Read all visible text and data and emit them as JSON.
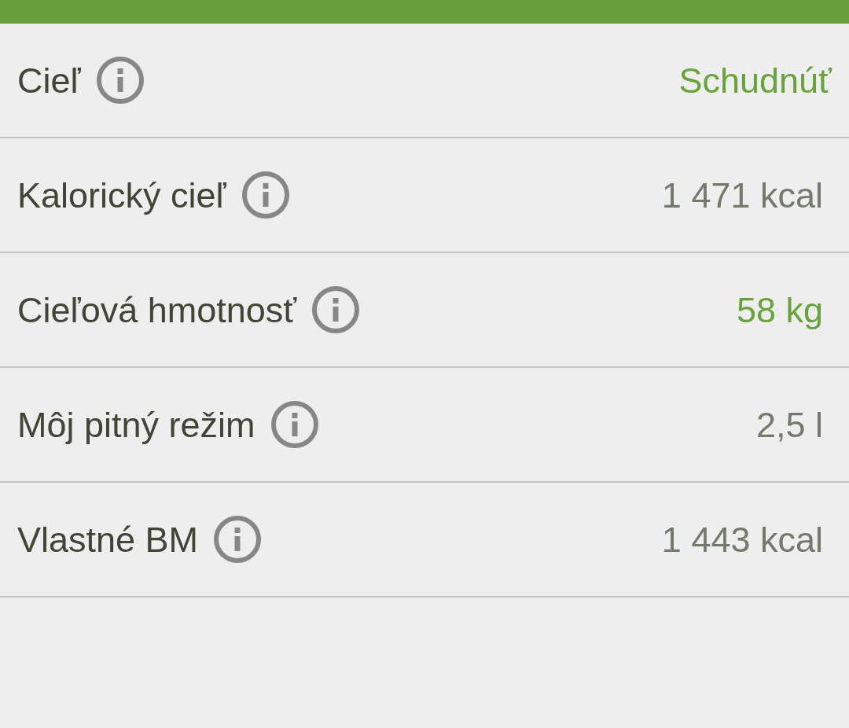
{
  "rows": [
    {
      "kind": "select",
      "label": "Cieľ",
      "value": "Schudnúť",
      "highlighted": true
    },
    {
      "kind": "value",
      "label": "Kalorický cieľ",
      "value": "1 471 kcal",
      "highlighted": false
    },
    {
      "kind": "value",
      "label": "Cieľová hmotnosť",
      "value": "58 kg",
      "highlighted": true
    },
    {
      "kind": "value",
      "label": "Môj pitný režim",
      "value": "2,5 l",
      "highlighted": false
    },
    {
      "kind": "value",
      "label": "Vlastné BM",
      "value": "1 443 kcal",
      "highlighted": false
    }
  ]
}
